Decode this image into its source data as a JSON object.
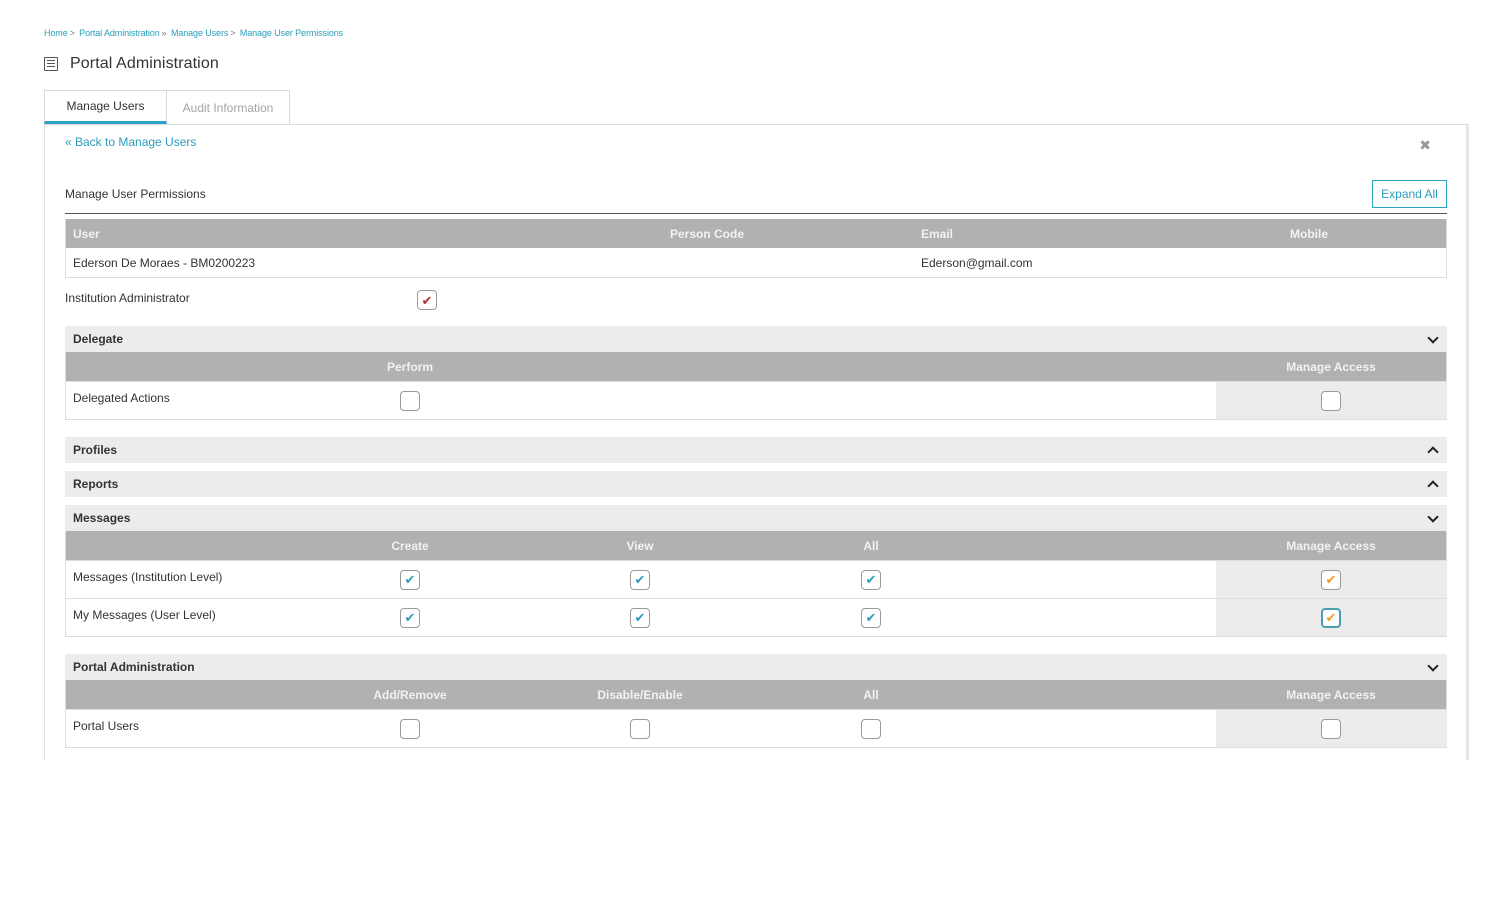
{
  "breadcrumb": [
    {
      "label": "Home",
      "sep": ">"
    },
    {
      "label": "Portal Administration",
      "sep": "»"
    },
    {
      "label": "Manage Users",
      "sep": ">"
    },
    {
      "label": "Manage User Permissions",
      "sep": ""
    }
  ],
  "page": {
    "title": "Portal Administration",
    "icon": "list-document-icon"
  },
  "tabs": [
    {
      "label": "Manage Users",
      "active": true
    },
    {
      "label": "Audit Information",
      "active": false
    }
  ],
  "panel": {
    "back_link": "« Back to Manage Users",
    "close_icon": "✖",
    "section_title": "Manage User Permissions",
    "expand_all": "Expand All"
  },
  "user_table": {
    "headers": {
      "user": "User",
      "person_code": "Person Code",
      "email": "Email",
      "mobile": "Mobile"
    },
    "row": {
      "user": "Ederson De Moraes - BM0200223",
      "person_code": "",
      "email": "Ederson@gmail.com",
      "mobile": ""
    }
  },
  "institution_admin": {
    "label": "Institution Administrator",
    "checked": true
  },
  "check_glyph": "✔",
  "groups": {
    "delegate": {
      "name": "Delegate",
      "expanded": true,
      "columns": {
        "perform": "Perform",
        "manage_access": "Manage Access"
      },
      "rows": [
        {
          "label": "Delegated Actions",
          "perform": false,
          "manage_access": false
        }
      ]
    },
    "profiles": {
      "name": "Profiles",
      "expanded": false
    },
    "reports": {
      "name": "Reports",
      "expanded": false
    },
    "messages": {
      "name": "Messages",
      "expanded": true,
      "columns": {
        "create": "Create",
        "view": "View",
        "all": "All",
        "manage_access": "Manage Access"
      },
      "rows": [
        {
          "label": "Messages (Institution Level)",
          "create": true,
          "view": true,
          "all": true,
          "manage_access": true
        },
        {
          "label": "My Messages (User Level)",
          "create": true,
          "view": true,
          "all": true,
          "manage_access": true
        }
      ]
    },
    "portal_admin": {
      "name": "Portal Administration",
      "expanded": true,
      "columns": {
        "add_remove": "Add/Remove",
        "disable_enable": "Disable/Enable",
        "all": "All",
        "manage_access": "Manage Access"
      },
      "rows": [
        {
          "label": "Portal Users",
          "add_remove": false,
          "disable_enable": false,
          "all": false,
          "manage_access": false
        }
      ]
    }
  },
  "colors": {
    "accent": "#2aa3c4",
    "link": "#2a9dbb",
    "check_teal": "#2a9dbb",
    "check_red": "#b02c2c",
    "check_orange": "#ef9b2a",
    "header_gray": "#b1b1b1",
    "group_gray": "#ececec"
  }
}
